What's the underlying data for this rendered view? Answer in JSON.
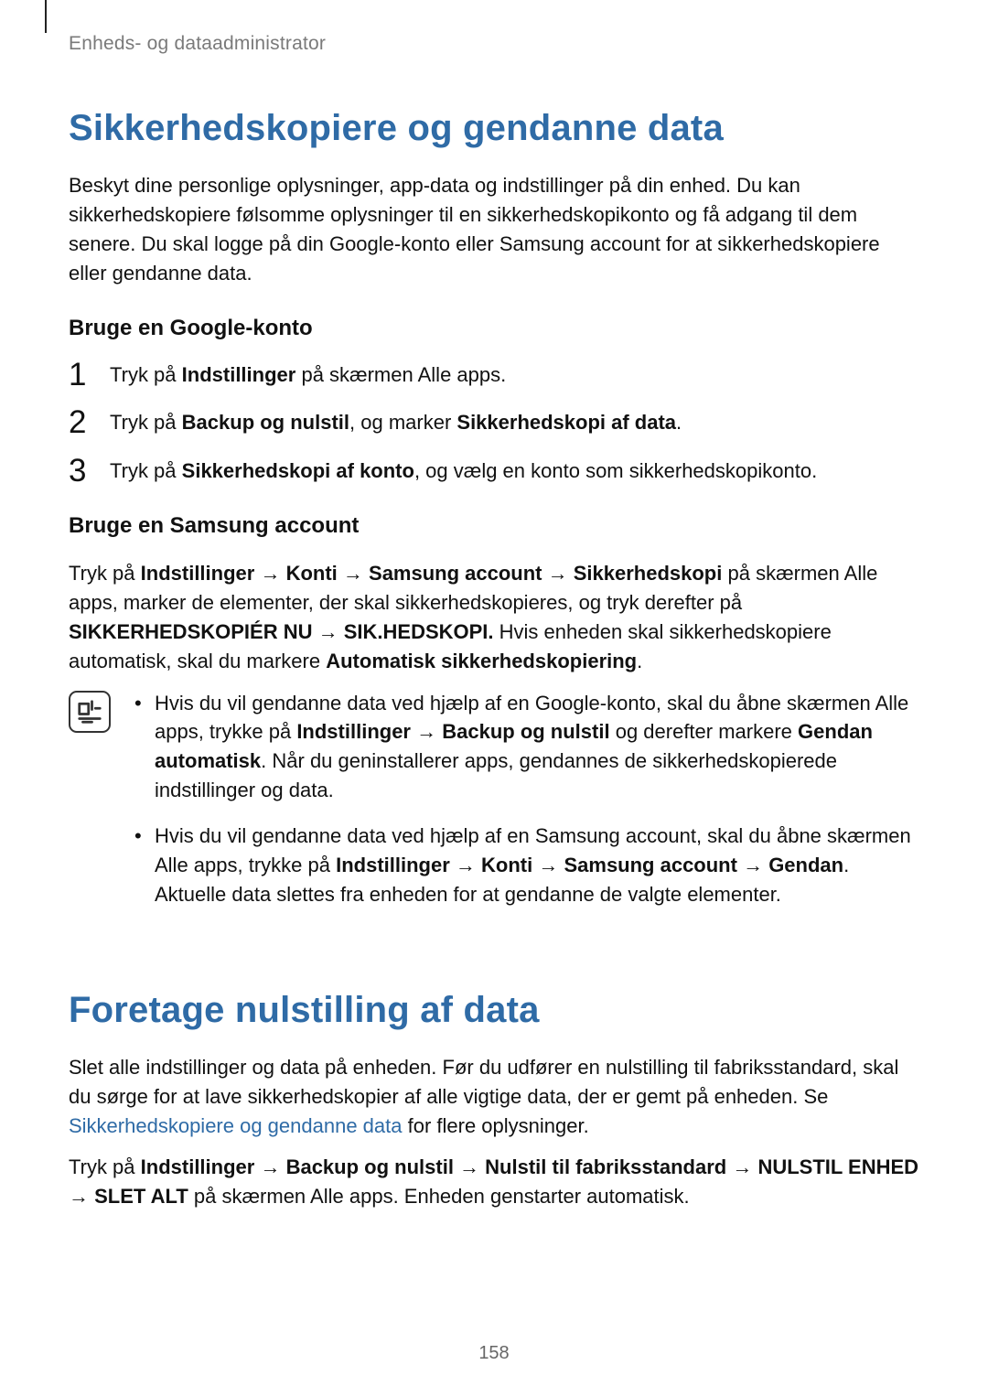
{
  "header": "Enheds- og dataadministrator",
  "section1": {
    "title": "Sikkerhedskopiere og gendanne data",
    "intro": "Beskyt dine personlige oplysninger, app-data og indstillinger på din enhed. Du kan sikkerhedskopiere følsomme oplysninger til en sikkerhedskopikonto og få adgang til dem senere. Du skal logge på din Google-konto eller Samsung account for at sikkerhedskopiere eller gendanne data.",
    "sub1": {
      "heading": "Bruge en Google-konto",
      "steps": [
        {
          "pre": "Tryk på ",
          "b1": "Indstillinger",
          "post": " på skærmen Alle apps."
        },
        {
          "pre": "Tryk på ",
          "b1": "Backup og nulstil",
          "mid": ", og marker ",
          "b2": "Sikkerhedskopi af data",
          "post": "."
        },
        {
          "pre": "Tryk på ",
          "b1": "Sikkerhedskopi af konto",
          "post": ", og vælg en konto som sikkerhedskopikonto."
        }
      ]
    },
    "sub2": {
      "heading": "Bruge en Samsung account",
      "para_parts": {
        "p1": "Tryk på ",
        "b1": "Indstillinger",
        "arr1": " → ",
        "b2": "Konti",
        "arr2": " → ",
        "b3": "Samsung account",
        "arr3": " → ",
        "b4": "Sikkerhedskopi",
        "p2": " på skærmen Alle apps, marker de elementer, der skal sikkerhedskopieres, og tryk derefter på ",
        "b5": "SIKKERHEDSKOPIÉR NU",
        "arr4": " → ",
        "b6": "SIK.HEDSKOPI.",
        "p3": " Hvis enheden skal sikkerhedskopiere automatisk, skal du markere ",
        "b7": "Automatisk sikkerhedskopiering",
        "p4": "."
      },
      "note": {
        "bullets": [
          {
            "t1": "Hvis du vil gendanne data ved hjælp af en Google-konto, skal du åbne skærmen Alle apps, trykke på ",
            "b1": "Indstillinger",
            "arr1": " → ",
            "b2": "Backup og nulstil",
            "t2": " og derefter markere ",
            "b3": "Gendan automatisk",
            "t3": ". Når du geninstallerer apps, gendannes de sikkerhedskopierede indstillinger og data."
          },
          {
            "t1": "Hvis du vil gendanne data ved hjælp af en Samsung account, skal du åbne skærmen Alle apps, trykke på ",
            "b1": "Indstillinger",
            "arr1": " → ",
            "b2": "Konti",
            "arr2": " → ",
            "b3": "Samsung account",
            "arr3": " → ",
            "b4": "Gendan",
            "t2": ". Aktuelle data slettes fra enheden for at gendanne de valgte elementer."
          }
        ]
      }
    }
  },
  "section2": {
    "title": "Foretage nulstilling af data",
    "para1_parts": {
      "t1": "Slet alle indstillinger og data på enheden. Før du udfører en nulstilling til fabriksstandard, skal du sørge for at lave sikkerhedskopier af alle vigtige data, der er gemt på enheden. Se ",
      "link": "Sikkerhedskopiere og gendanne data",
      "t2": " for flere oplysninger."
    },
    "para2_parts": {
      "t1": "Tryk på ",
      "b1": "Indstillinger",
      "arr1": " → ",
      "b2": "Backup og nulstil",
      "arr2": " → ",
      "b3": "Nulstil til fabriksstandard",
      "arr3": " → ",
      "b4": "NULSTIL ENHED",
      "arr4": " → ",
      "b5": "SLET ALT",
      "t2": " på skærmen Alle apps. Enheden genstarter automatisk."
    }
  },
  "page_number": "158"
}
